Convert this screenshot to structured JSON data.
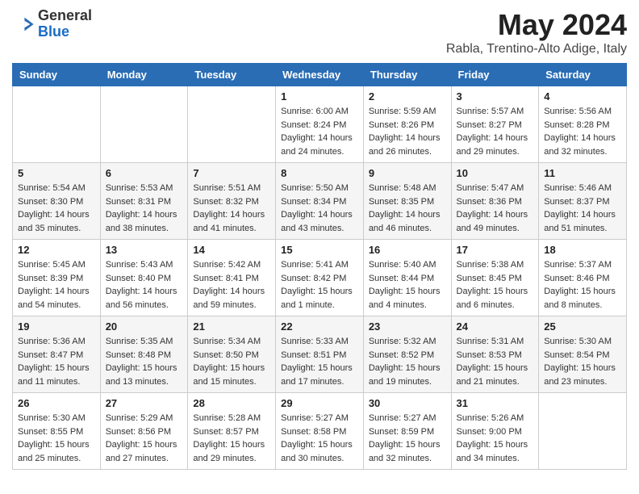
{
  "header": {
    "logo_general": "General",
    "logo_blue": "Blue",
    "month_title": "May 2024",
    "location": "Rabla, Trentino-Alto Adige, Italy"
  },
  "days_of_week": [
    "Sunday",
    "Monday",
    "Tuesday",
    "Wednesday",
    "Thursday",
    "Friday",
    "Saturday"
  ],
  "weeks": [
    [
      {
        "day": "",
        "info": ""
      },
      {
        "day": "",
        "info": ""
      },
      {
        "day": "",
        "info": ""
      },
      {
        "day": "1",
        "info": "Sunrise: 6:00 AM\nSunset: 8:24 PM\nDaylight: 14 hours\nand 24 minutes."
      },
      {
        "day": "2",
        "info": "Sunrise: 5:59 AM\nSunset: 8:26 PM\nDaylight: 14 hours\nand 26 minutes."
      },
      {
        "day": "3",
        "info": "Sunrise: 5:57 AM\nSunset: 8:27 PM\nDaylight: 14 hours\nand 29 minutes."
      },
      {
        "day": "4",
        "info": "Sunrise: 5:56 AM\nSunset: 8:28 PM\nDaylight: 14 hours\nand 32 minutes."
      }
    ],
    [
      {
        "day": "5",
        "info": "Sunrise: 5:54 AM\nSunset: 8:30 PM\nDaylight: 14 hours\nand 35 minutes."
      },
      {
        "day": "6",
        "info": "Sunrise: 5:53 AM\nSunset: 8:31 PM\nDaylight: 14 hours\nand 38 minutes."
      },
      {
        "day": "7",
        "info": "Sunrise: 5:51 AM\nSunset: 8:32 PM\nDaylight: 14 hours\nand 41 minutes."
      },
      {
        "day": "8",
        "info": "Sunrise: 5:50 AM\nSunset: 8:34 PM\nDaylight: 14 hours\nand 43 minutes."
      },
      {
        "day": "9",
        "info": "Sunrise: 5:48 AM\nSunset: 8:35 PM\nDaylight: 14 hours\nand 46 minutes."
      },
      {
        "day": "10",
        "info": "Sunrise: 5:47 AM\nSunset: 8:36 PM\nDaylight: 14 hours\nand 49 minutes."
      },
      {
        "day": "11",
        "info": "Sunrise: 5:46 AM\nSunset: 8:37 PM\nDaylight: 14 hours\nand 51 minutes."
      }
    ],
    [
      {
        "day": "12",
        "info": "Sunrise: 5:45 AM\nSunset: 8:39 PM\nDaylight: 14 hours\nand 54 minutes."
      },
      {
        "day": "13",
        "info": "Sunrise: 5:43 AM\nSunset: 8:40 PM\nDaylight: 14 hours\nand 56 minutes."
      },
      {
        "day": "14",
        "info": "Sunrise: 5:42 AM\nSunset: 8:41 PM\nDaylight: 14 hours\nand 59 minutes."
      },
      {
        "day": "15",
        "info": "Sunrise: 5:41 AM\nSunset: 8:42 PM\nDaylight: 15 hours\nand 1 minute."
      },
      {
        "day": "16",
        "info": "Sunrise: 5:40 AM\nSunset: 8:44 PM\nDaylight: 15 hours\nand 4 minutes."
      },
      {
        "day": "17",
        "info": "Sunrise: 5:38 AM\nSunset: 8:45 PM\nDaylight: 15 hours\nand 6 minutes."
      },
      {
        "day": "18",
        "info": "Sunrise: 5:37 AM\nSunset: 8:46 PM\nDaylight: 15 hours\nand 8 minutes."
      }
    ],
    [
      {
        "day": "19",
        "info": "Sunrise: 5:36 AM\nSunset: 8:47 PM\nDaylight: 15 hours\nand 11 minutes."
      },
      {
        "day": "20",
        "info": "Sunrise: 5:35 AM\nSunset: 8:48 PM\nDaylight: 15 hours\nand 13 minutes."
      },
      {
        "day": "21",
        "info": "Sunrise: 5:34 AM\nSunset: 8:50 PM\nDaylight: 15 hours\nand 15 minutes."
      },
      {
        "day": "22",
        "info": "Sunrise: 5:33 AM\nSunset: 8:51 PM\nDaylight: 15 hours\nand 17 minutes."
      },
      {
        "day": "23",
        "info": "Sunrise: 5:32 AM\nSunset: 8:52 PM\nDaylight: 15 hours\nand 19 minutes."
      },
      {
        "day": "24",
        "info": "Sunrise: 5:31 AM\nSunset: 8:53 PM\nDaylight: 15 hours\nand 21 minutes."
      },
      {
        "day": "25",
        "info": "Sunrise: 5:30 AM\nSunset: 8:54 PM\nDaylight: 15 hours\nand 23 minutes."
      }
    ],
    [
      {
        "day": "26",
        "info": "Sunrise: 5:30 AM\nSunset: 8:55 PM\nDaylight: 15 hours\nand 25 minutes."
      },
      {
        "day": "27",
        "info": "Sunrise: 5:29 AM\nSunset: 8:56 PM\nDaylight: 15 hours\nand 27 minutes."
      },
      {
        "day": "28",
        "info": "Sunrise: 5:28 AM\nSunset: 8:57 PM\nDaylight: 15 hours\nand 29 minutes."
      },
      {
        "day": "29",
        "info": "Sunrise: 5:27 AM\nSunset: 8:58 PM\nDaylight: 15 hours\nand 30 minutes."
      },
      {
        "day": "30",
        "info": "Sunrise: 5:27 AM\nSunset: 8:59 PM\nDaylight: 15 hours\nand 32 minutes."
      },
      {
        "day": "31",
        "info": "Sunrise: 5:26 AM\nSunset: 9:00 PM\nDaylight: 15 hours\nand 34 minutes."
      },
      {
        "day": "",
        "info": ""
      }
    ]
  ]
}
